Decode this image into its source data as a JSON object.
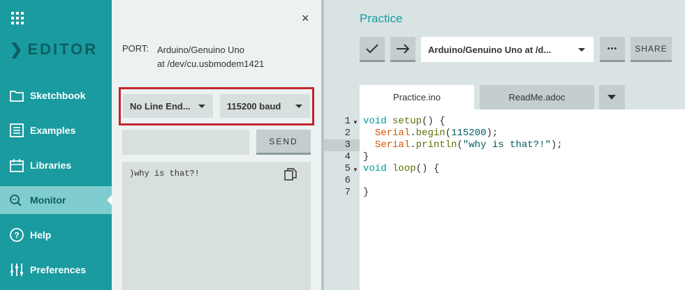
{
  "nav": {
    "logo": "EDITOR",
    "items": [
      {
        "label": "Sketchbook",
        "icon": "folder-icon"
      },
      {
        "label": "Examples",
        "icon": "list-icon"
      },
      {
        "label": "Libraries",
        "icon": "libraries-icon"
      },
      {
        "label": "Monitor",
        "icon": "monitor-search-icon",
        "active": true
      },
      {
        "label": "Help",
        "icon": "help-icon"
      },
      {
        "label": "Preferences",
        "icon": "sliders-icon"
      }
    ]
  },
  "monitor": {
    "close": "×",
    "port_label": "PORT:",
    "port_line1": "Arduino/Genuino Uno",
    "port_line2": "at /dev/cu.usbmodem1421",
    "line_ending": "No Line End...",
    "baud": "115200 baud",
    "send_input_value": "",
    "send_label": "SEND",
    "output": ")why is that?!"
  },
  "editor": {
    "sketch_title": "Practice",
    "board": "Arduino/Genuino Uno at /d...",
    "more": "•••",
    "share": "SHARE",
    "tabs": [
      {
        "label": "Practice.ino",
        "active": true
      },
      {
        "label": "ReadMe.adoc",
        "active": false
      }
    ],
    "line_numbers": [
      "1",
      "2",
      "3",
      "4",
      "5",
      "6",
      "7"
    ],
    "highlighted_line": 3
  },
  "colors": {
    "nav_bg": "#1a9b9f",
    "nav_active": "#7fcdcf",
    "highlight_border": "#c1272d",
    "accent": "#1a9b9f"
  }
}
